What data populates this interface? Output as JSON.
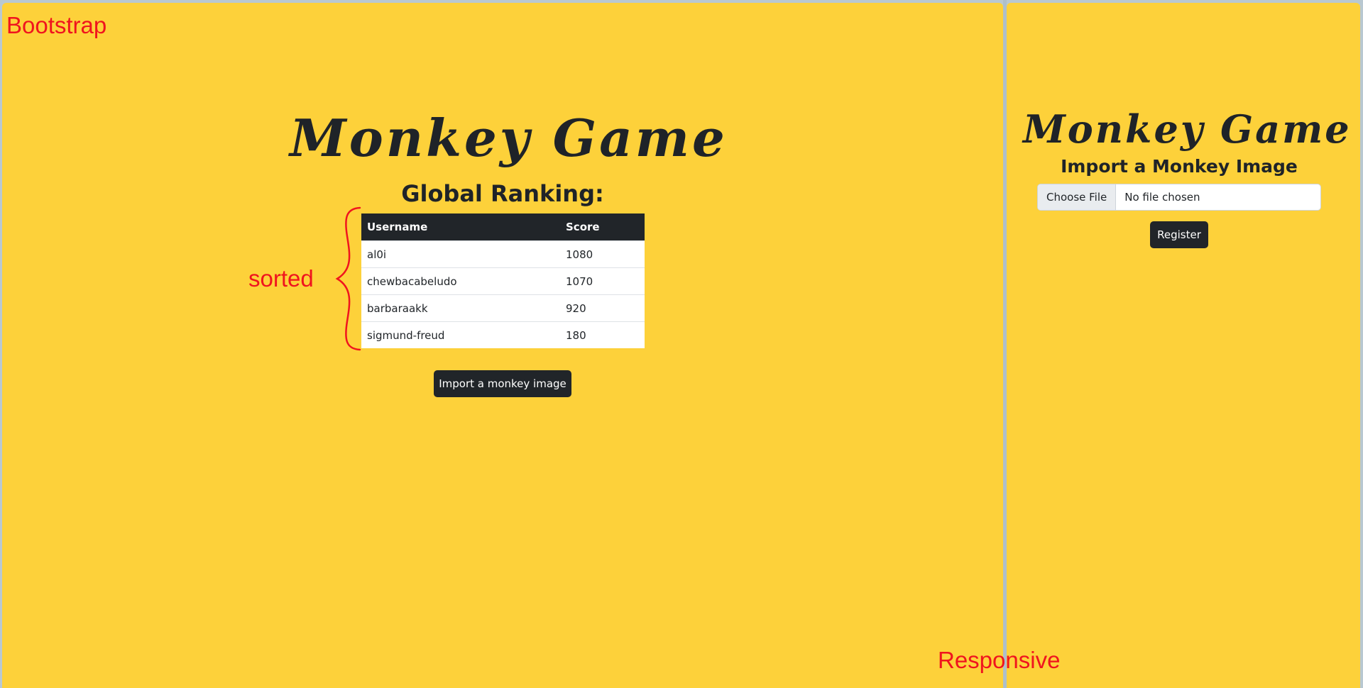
{
  "annotations": {
    "bootstrap": "Bootstrap",
    "sorted": "sorted",
    "responsive": "Responsive"
  },
  "desktop": {
    "title": "Monkey Game",
    "ranking_heading": "Global Ranking:",
    "table": {
      "headers": [
        "Username",
        "Score"
      ],
      "rows": [
        {
          "username": "al0i",
          "score": "1080"
        },
        {
          "username": "chewbacabeludo",
          "score": "1070"
        },
        {
          "username": "barbaraakk",
          "score": "920"
        },
        {
          "username": "sigmund-freud",
          "score": "180"
        }
      ]
    },
    "import_button_label": "Import a monkey image"
  },
  "mobile": {
    "title": "Monkey Game",
    "import_heading": "Import a Monkey Image",
    "file_input": {
      "button_label": "Choose File",
      "status": "No file chosen"
    },
    "register_button_label": "Register"
  },
  "colors": {
    "background": "#fdd13a",
    "dark": "#212529",
    "annotation": "#f0141e"
  }
}
